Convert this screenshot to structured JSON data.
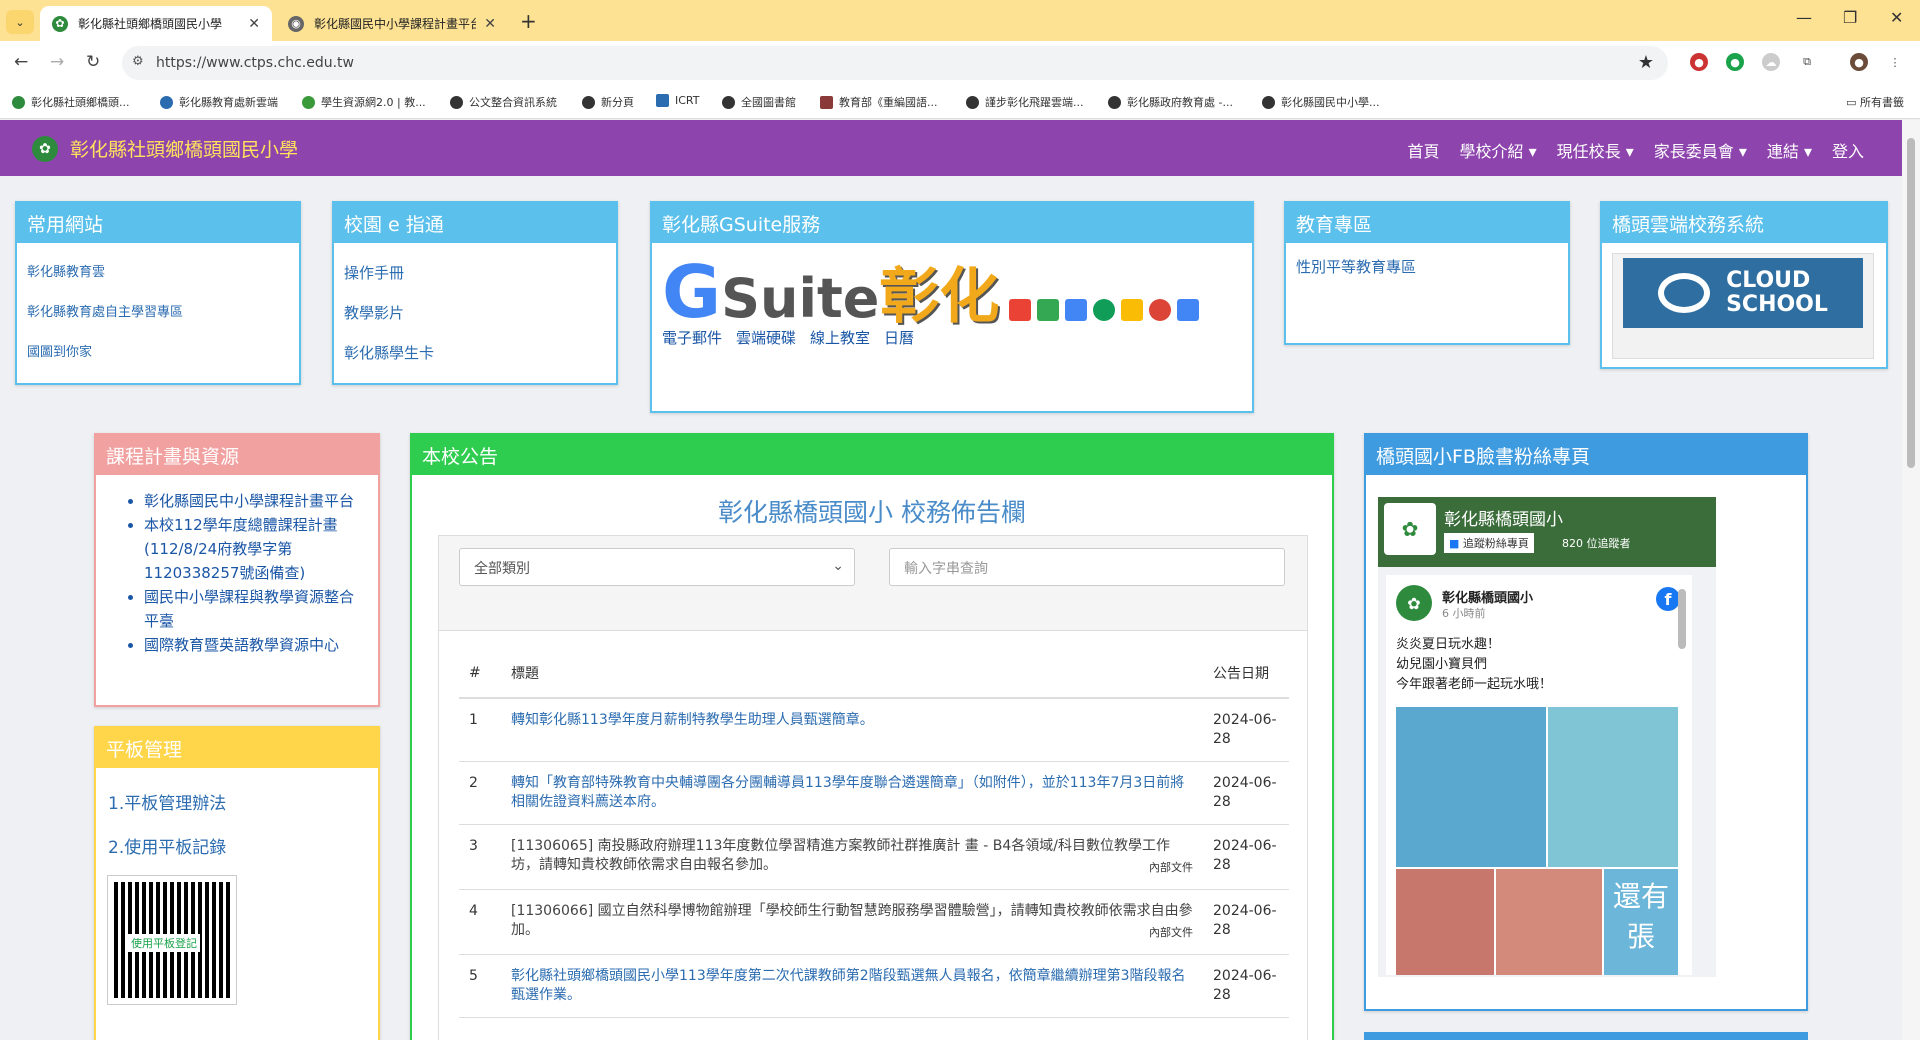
{
  "browser": {
    "tabs": [
      {
        "title": "彰化縣社頭鄉橋頭國民小學"
      },
      {
        "title": "彰化縣國民中小學課程計畫平台"
      }
    ],
    "url": "https://www.ctps.chc.edu.tw",
    "bookmarks": [
      "彰化縣社頭鄉橋頭...",
      "彰化縣教育處新雲端",
      "學生資源網2.0 | 教...",
      "公文整合資訊系統",
      "新分頁",
      "ICRT",
      "全國圖書館",
      "教育部《重編國語...",
      "謹步彰化飛躍雲端...",
      "彰化縣政府教育處 -...",
      "彰化縣國民中小學..."
    ],
    "bookmarks_all": "所有書籤"
  },
  "site": {
    "name": "彰化縣社頭鄉橋頭國民小學",
    "menu": [
      "首頁",
      "學校介紹 ▾",
      "現任校長 ▾",
      "家長委員會 ▾",
      "連結 ▾",
      "登入"
    ]
  },
  "panels": {
    "common": {
      "title": "常用網站",
      "links": [
        "彰化縣教育雲",
        "彰化縣教育處自主學習專區",
        "國圖到你家"
      ]
    },
    "campus": {
      "title": "校園 e 指通",
      "links": [
        "操作手冊",
        "教學影片",
        "彰化縣學生卡"
      ]
    },
    "gsuite": {
      "title": "彰化縣GSuite服務",
      "logo_g": "G",
      "logo_suite": "Suite",
      "logo_zh": "彰化",
      "links": [
        "電子郵件",
        "雲端硬碟",
        "線上教室",
        "日曆"
      ]
    },
    "edu": {
      "title": "教育專區",
      "links": [
        "性別平等教育專區"
      ]
    },
    "cloud": {
      "title": "橋頭雲端校務系統",
      "text1": "CLOUD",
      "text2": "SCHOOL"
    },
    "curriculum": {
      "title": "課程計畫與資源",
      "items": [
        "彰化縣國民中小學課程計畫平台",
        "本校112學年度總體課程計畫(112/8/24府教學字第1120338257號函備查)",
        "國民中小學課程與教學資源整合平臺",
        "國際教育暨英語教學資源中心"
      ]
    },
    "tablet": {
      "title": "平板管理",
      "items": [
        "1.平板管理辦法",
        "2.使用平板記錄"
      ],
      "qr_label": "使用平板登記"
    },
    "announce": {
      "title": "本校公告",
      "heading": "彰化縣橋頭國小 校務佈告欄",
      "select": "全部類別",
      "search_placeholder": "輸入字串查詢",
      "columns": [
        "#",
        "標題",
        "公告日期"
      ],
      "rows": [
        {
          "n": "1",
          "title": "轉知彰化縣113學年度月薪制特教學生助理人員甄選簡章。",
          "date": "2024-06-28",
          "tag": ""
        },
        {
          "n": "2",
          "title": "轉知「教育部特殊教育中央輔導團各分團輔導員113學年度聯合遴選簡章」（如附件），並於113年7月3日前將相關佐證資料薦送本府。",
          "date": "2024-06-28",
          "tag": ""
        },
        {
          "n": "3",
          "title": "[11306065] 南投縣政府辦理113年度數位學習精進方案教師社群推廣計 畫 - B4各領域/科目數位教學工作坊，請轉知貴校教師依需求自由報名參加。",
          "date": "2024-06-28",
          "tag": "內部文件"
        },
        {
          "n": "4",
          "title": "[11306066] 國立自然科學博物館辦理「學校師生行動智慧跨服務學習體驗營」，請轉知貴校教師依需求自由參加。",
          "date": "2024-06-28",
          "tag": "內部文件"
        },
        {
          "n": "5",
          "title": "彰化縣社頭鄉橋頭國民小學113學年度第二次代課教師第2階段甄選無人員報名，依簡章繼續辦理第3階段報名甄選作業。",
          "date": "2024-06-28",
          "tag": ""
        }
      ]
    },
    "fb": {
      "title": "橋頭國小FB臉書粉絲專頁",
      "page_name": "彰化縣橋頭國小",
      "follow": "追蹤粉絲專頁",
      "followers": "820 位追蹤者",
      "post_name": "彰化縣橋頭國小",
      "post_time": "6 小時前",
      "post_text": "炎炎夏日玩水趣！\n幼兒園小寶貝們\n今年跟著老師一起玩水哦！",
      "more": "還有\n張"
    }
  }
}
